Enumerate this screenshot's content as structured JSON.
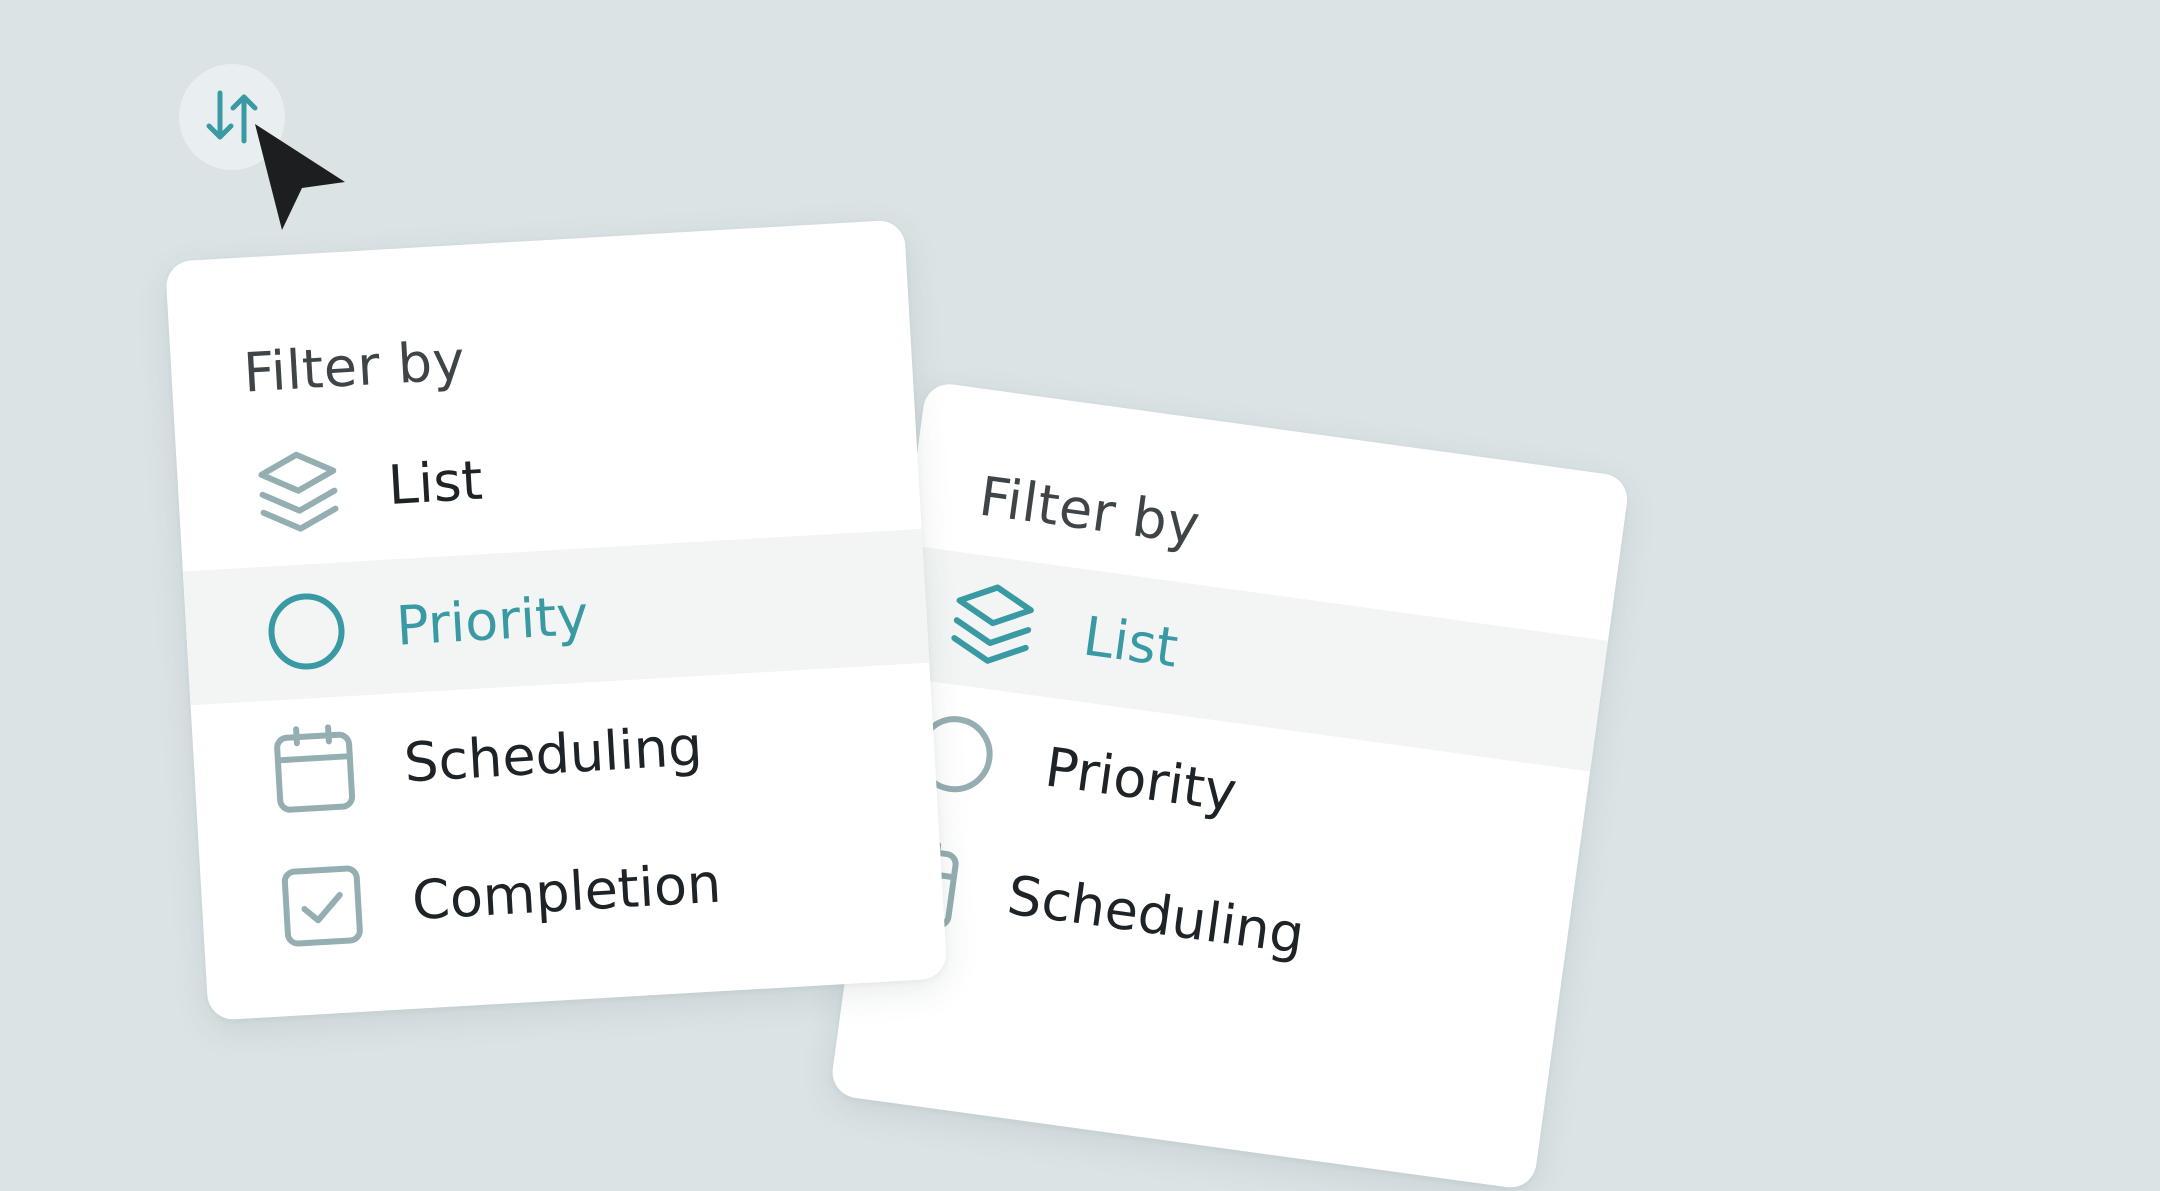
{
  "colors": {
    "background": "#dbe3e5",
    "accent": "#3a9aa3",
    "icon_muted": "#94aeb1",
    "selected_row": "#f2f5f4",
    "text": "#1d2326",
    "title_text": "#3f4547"
  },
  "sort_button": {
    "icon": "sort-arrows-icon"
  },
  "cursor": {
    "icon": "pointer-cursor-icon"
  },
  "left_menu": {
    "title": "Filter by",
    "items": [
      {
        "label": "List",
        "icon": "layers-icon",
        "selected": false
      },
      {
        "label": "Priority",
        "icon": "circle-icon",
        "selected": true
      },
      {
        "label": "Scheduling",
        "icon": "calendar-icon",
        "selected": false
      },
      {
        "label": "Completion",
        "icon": "checkbox-icon",
        "selected": false
      }
    ]
  },
  "right_menu": {
    "title": "Filter by",
    "items": [
      {
        "label": "List",
        "icon": "layers-icon",
        "selected": true
      },
      {
        "label": "Priority",
        "icon": "circle-icon",
        "selected": false
      },
      {
        "label": "Scheduling",
        "icon": "calendar-icon",
        "selected": false
      }
    ]
  }
}
